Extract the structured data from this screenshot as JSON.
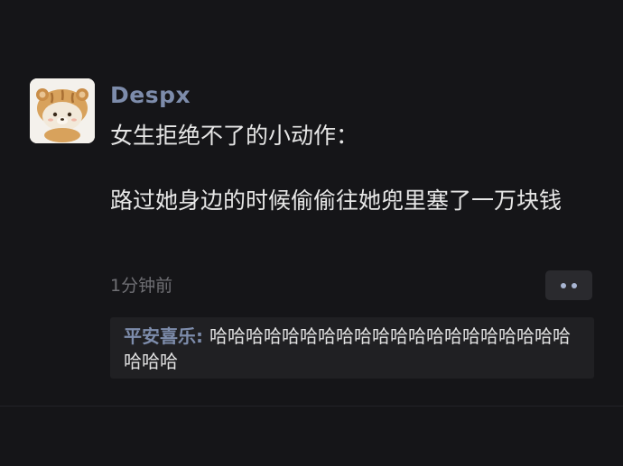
{
  "post": {
    "author": "Despx",
    "text": "女生拒绝不了的小动作：\n\n路过她身边的时候偷偷往她兜里塞了一万块钱",
    "timestamp": "1分钟前"
  },
  "avatar": {
    "icon": "bear-avatar-icon"
  },
  "more_button": {
    "icon": "two-dots-icon"
  },
  "comments": [
    {
      "author": "平安喜乐",
      "separator": ": ",
      "text": "哈哈哈哈哈哈哈哈哈哈哈哈哈哈哈哈哈哈哈哈哈哈哈"
    }
  ],
  "colors": {
    "background": "#151518",
    "username": "#7d8cab",
    "text": "#e6e6e6",
    "timestamp": "#6f6f74",
    "comment_box": "#202023"
  }
}
